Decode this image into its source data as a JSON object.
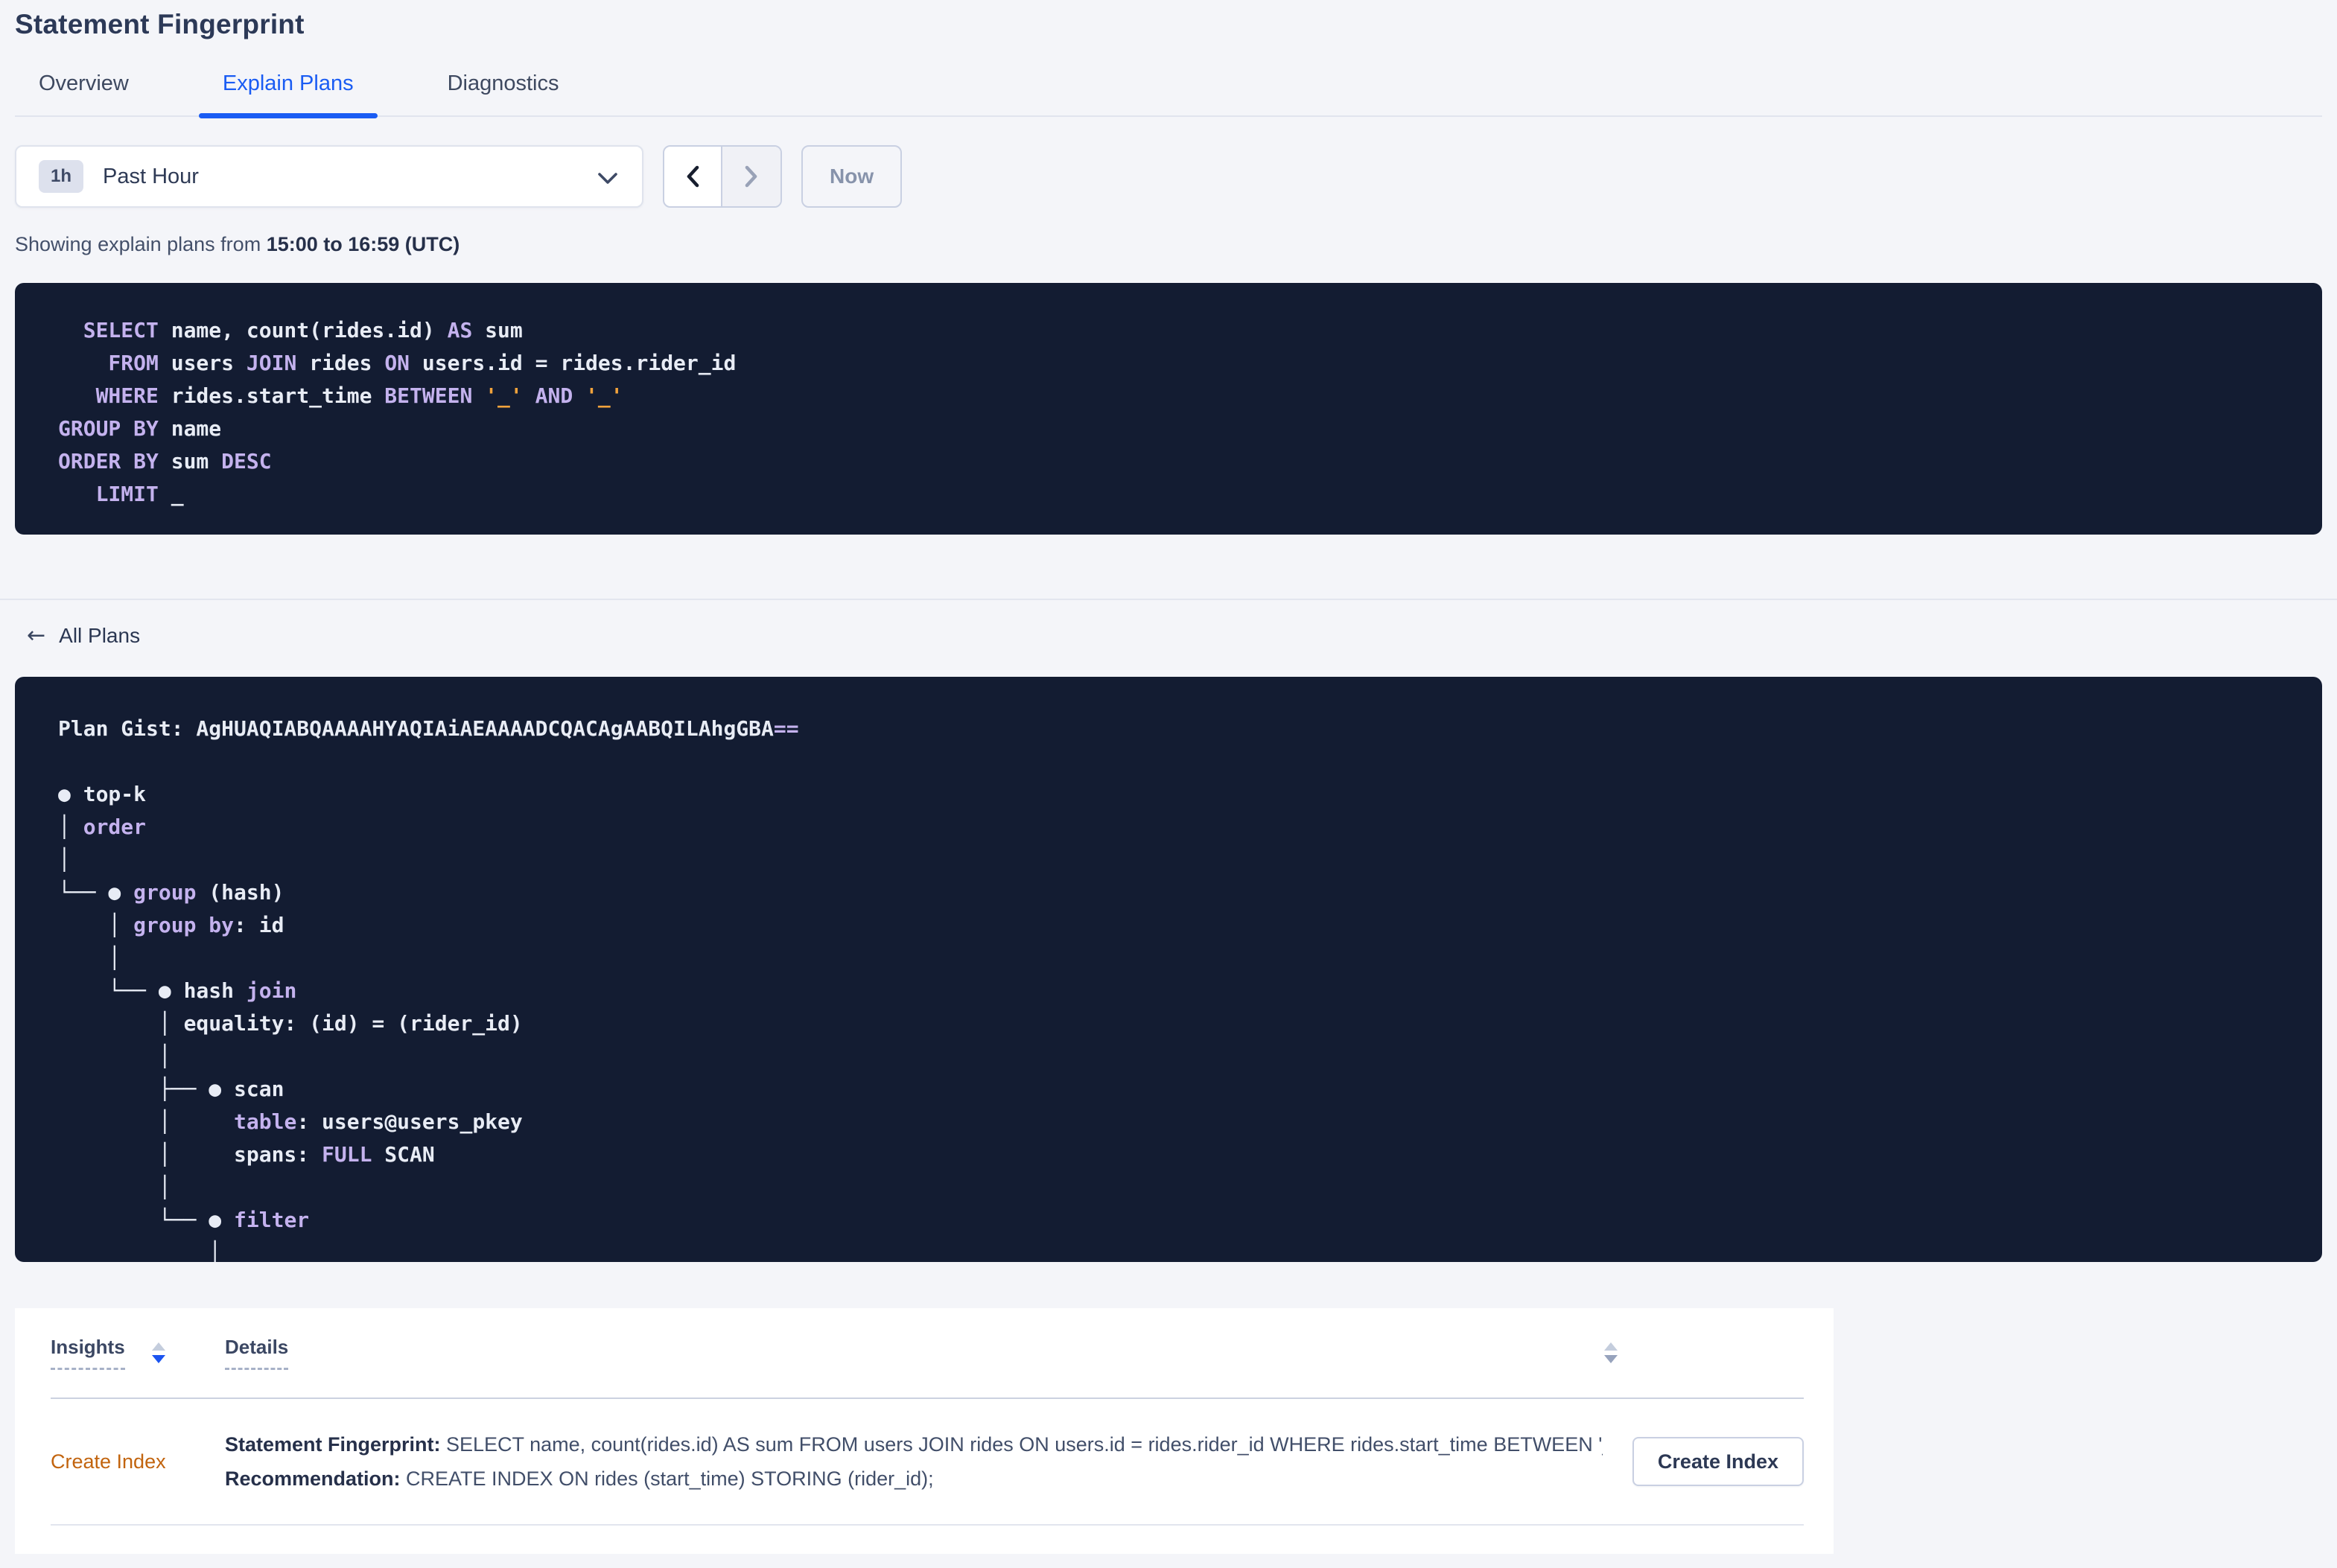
{
  "page_title": "Statement Fingerprint",
  "tabs": [
    {
      "label": "Overview",
      "active": false
    },
    {
      "label": "Explain Plans",
      "active": true
    },
    {
      "label": "Diagnostics",
      "active": false
    }
  ],
  "time_picker": {
    "badge": "1h",
    "label": "Past Hour"
  },
  "pager": {
    "now_label": "Now"
  },
  "showing": {
    "prefix": "Showing explain plans from ",
    "range": "15:00 to 16:59 (UTC)"
  },
  "sql_block": {
    "lines": [
      {
        "segments": [
          [
            "kw",
            "  SELECT"
          ],
          [
            "id",
            " name, count(rides.id) "
          ],
          [
            "kw",
            "AS"
          ],
          [
            "id",
            " sum"
          ]
        ]
      },
      {
        "segments": [
          [
            "kw",
            "    FROM"
          ],
          [
            "id",
            " users "
          ],
          [
            "kw",
            "JOIN"
          ],
          [
            "id",
            " rides "
          ],
          [
            "kw",
            "ON"
          ],
          [
            "id",
            " users.id = rides.rider_id"
          ]
        ]
      },
      {
        "segments": [
          [
            "kw",
            "   WHERE"
          ],
          [
            "id",
            " rides.start_time "
          ],
          [
            "kw",
            "BETWEEN"
          ],
          [
            "id",
            " "
          ],
          [
            "str",
            "'_'"
          ],
          [
            "id",
            " "
          ],
          [
            "kw",
            "AND"
          ],
          [
            "id",
            " "
          ],
          [
            "str",
            "'_'"
          ]
        ]
      },
      {
        "segments": [
          [
            "kw",
            "GROUP BY"
          ],
          [
            "id",
            " name"
          ]
        ]
      },
      {
        "segments": [
          [
            "kw",
            "ORDER BY"
          ],
          [
            "id",
            " sum "
          ],
          [
            "kw",
            "DESC"
          ]
        ]
      },
      {
        "segments": [
          [
            "kw",
            "   LIMIT"
          ],
          [
            "id",
            " _"
          ]
        ]
      }
    ]
  },
  "back_link": {
    "label": "All Plans"
  },
  "plan_block": {
    "lines": [
      {
        "bold": true,
        "segments": [
          [
            "id",
            "Plan Gist: AgHUAQIABQAAAAHYAQIAiAEAAAADCQACAgAABQILAhgGBA"
          ],
          [
            "kw",
            "=="
          ]
        ]
      },
      {
        "segments": []
      },
      {
        "segments": [
          [
            "id",
            "● top-k"
          ]
        ]
      },
      {
        "segments": [
          [
            "id",
            "│ "
          ],
          [
            "kw",
            "order"
          ]
        ]
      },
      {
        "segments": [
          [
            "id",
            "│"
          ]
        ]
      },
      {
        "segments": [
          [
            "id",
            "└── ● "
          ],
          [
            "kw",
            "group"
          ],
          [
            "id",
            " (hash)"
          ]
        ]
      },
      {
        "segments": [
          [
            "id",
            "    │ "
          ],
          [
            "kw",
            "group by"
          ],
          [
            "id",
            ": id"
          ]
        ]
      },
      {
        "segments": [
          [
            "id",
            "    │"
          ]
        ]
      },
      {
        "segments": [
          [
            "id",
            "    └── ● hash "
          ],
          [
            "kw",
            "join"
          ]
        ]
      },
      {
        "segments": [
          [
            "id",
            "        │ equality: (id) = (rider_id)"
          ]
        ]
      },
      {
        "segments": [
          [
            "id",
            "        │"
          ]
        ]
      },
      {
        "segments": [
          [
            "id",
            "        ├── ● scan"
          ]
        ]
      },
      {
        "segments": [
          [
            "id",
            "        │     "
          ],
          [
            "kw",
            "table"
          ],
          [
            "id",
            ": users@users_pkey"
          ]
        ]
      },
      {
        "segments": [
          [
            "id",
            "        │     spans: "
          ],
          [
            "kw",
            "FULL"
          ],
          [
            "id",
            " SCAN"
          ]
        ]
      },
      {
        "segments": [
          [
            "id",
            "        │"
          ]
        ]
      },
      {
        "segments": [
          [
            "id",
            "        └── ● "
          ],
          [
            "kw",
            "filter"
          ]
        ]
      },
      {
        "segments": [
          [
            "id",
            "            │"
          ]
        ]
      }
    ]
  },
  "insights_table": {
    "columns": [
      {
        "label": "Insights",
        "sorted": "desc"
      },
      {
        "label": "Details",
        "sorted": "none"
      }
    ],
    "row": {
      "insight_label": "Create Index",
      "detail_1_label": "Statement Fingerprint:",
      "detail_1_text": " SELECT name, count(rides.id) AS sum FROM users JOIN rides ON users.id = rides.rider_id WHERE rides.start_time BETWEEN '_…",
      "detail_2_label": "Recommendation:",
      "detail_2_text": " CREATE INDEX ON rides (start_time) STORING (rider_id);",
      "action_label": "Create Index"
    }
  },
  "colors": {
    "accent_blue": "#1a5cf3",
    "code_background": "#131c32",
    "code_keyword": "#c4b2ee",
    "code_string": "#f2a33c",
    "code_text": "#e8ecf5",
    "insight_orange": "#c2640e",
    "page_background": "#f4f5f9"
  }
}
